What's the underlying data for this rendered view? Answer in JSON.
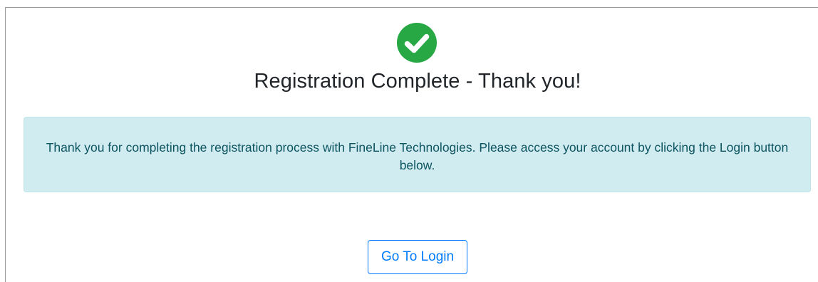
{
  "status": {
    "icon": "check-circle-icon",
    "color": "#28a745"
  },
  "title": "Registration Complete - Thank you!",
  "message": "Thank you for completing the registration process with FineLine Technologies. Please access your account by clicking the Login button below.",
  "colors": {
    "alert_bg": "#d1ecf1",
    "alert_text": "#0c5460",
    "button_accent": "#007bff"
  },
  "login_button": {
    "label": "Go To Login"
  }
}
